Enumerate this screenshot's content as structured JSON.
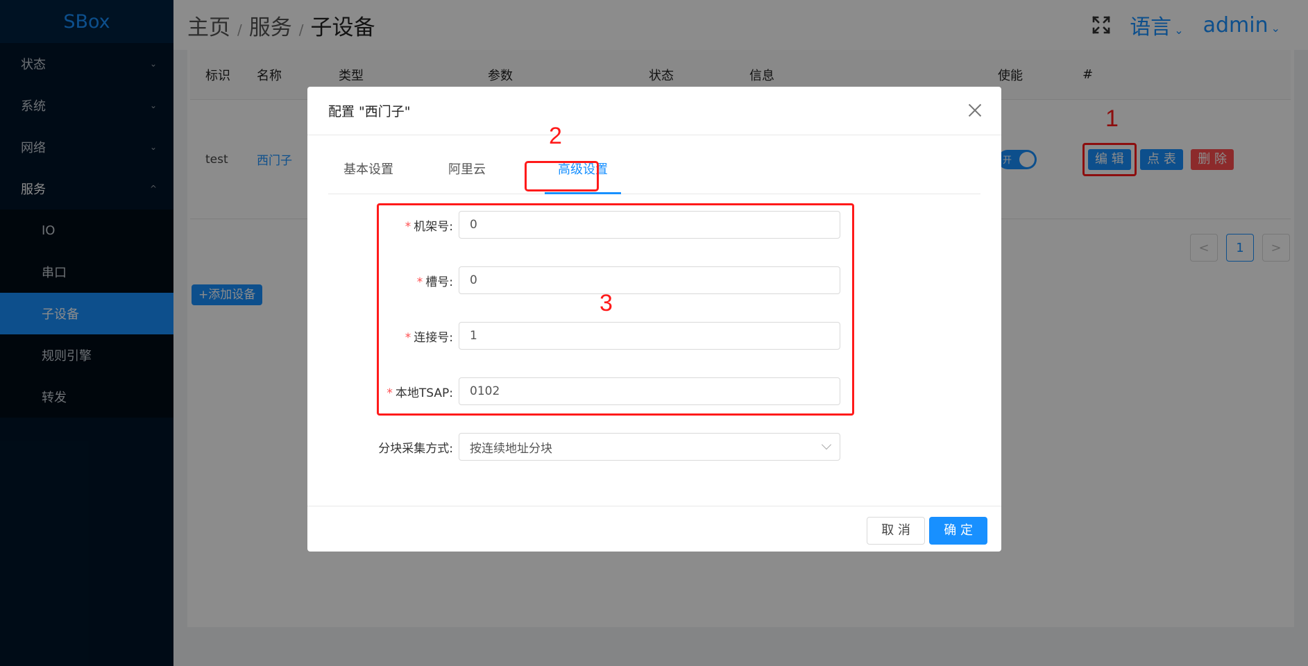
{
  "app": {
    "logo": "SBox"
  },
  "sidebar": {
    "items": [
      {
        "label": "状态",
        "chevron": "⌄"
      },
      {
        "label": "系统",
        "chevron": "⌄"
      },
      {
        "label": "网络",
        "chevron": "⌄"
      },
      {
        "label": "服务",
        "chevron": "^"
      }
    ],
    "subitems": [
      {
        "label": "IO"
      },
      {
        "label": "串口"
      },
      {
        "label": "子设备"
      },
      {
        "label": "规则引擎"
      },
      {
        "label": "转发"
      }
    ]
  },
  "header": {
    "breadcrumb": [
      "主页",
      "服务",
      "子设备"
    ],
    "separator": "/",
    "language": "语言",
    "user": "admin",
    "chevron": "⌄"
  },
  "table": {
    "headers": [
      "标识",
      "名称",
      "类型",
      "参数",
      "状态",
      "信息",
      "使能",
      "#"
    ],
    "row": {
      "id": "test",
      "name": "西门子",
      "toggle": "开"
    },
    "actions": {
      "edit": "编 辑",
      "points": "点 表",
      "delete": "删 除"
    }
  },
  "pager": {
    "prev": "<",
    "page": "1",
    "next": ">"
  },
  "add_button": "+添加设备",
  "annotations": [
    "1",
    "2",
    "3"
  ],
  "modal": {
    "title": "配置 \"西门子\"",
    "tabs": [
      "基本设置",
      "阿里云",
      "高级设置"
    ],
    "required_mark": "*",
    "fields": [
      {
        "label": "机架号:",
        "value": "0",
        "required": true
      },
      {
        "label": "槽号:",
        "value": "0",
        "required": true
      },
      {
        "label": "连接号:",
        "value": "1",
        "required": true
      },
      {
        "label": "本地TSAP:",
        "value": "0102",
        "required": true
      },
      {
        "label": "分块采集方式:",
        "value": "按连续地址分块",
        "required": false
      }
    ],
    "cancel": "取 消",
    "ok": "确 定"
  },
  "colors": {
    "accent": "#1890ff",
    "sidebar": "#001529",
    "danger": "#ff4d4f",
    "annotation": "#ff1a1a"
  }
}
